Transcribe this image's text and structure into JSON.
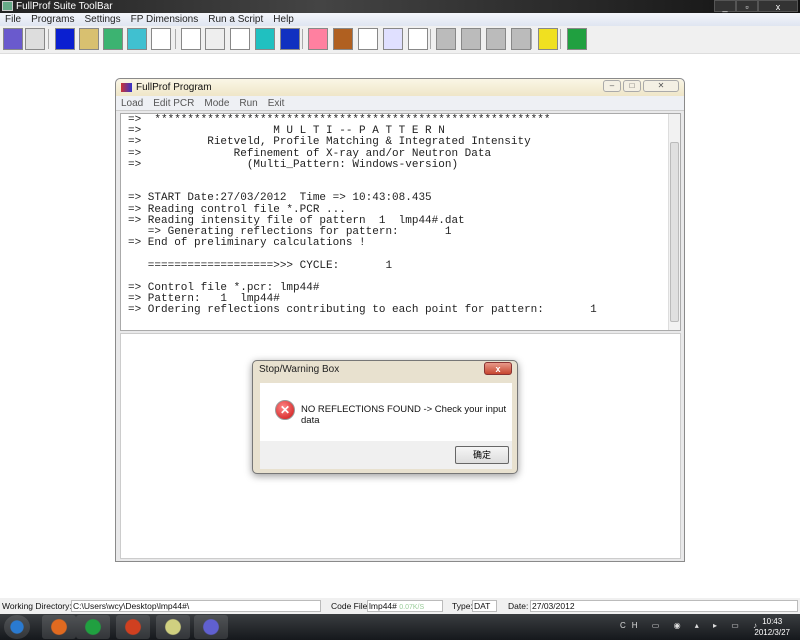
{
  "app": {
    "title": "FullProf Suite ToolBar",
    "window_controls": [
      "minimize",
      "restore",
      "close"
    ]
  },
  "menu": [
    "File",
    "Programs",
    "Settings",
    "FP Dimensions",
    "Run a Script",
    "Help"
  ],
  "toolbar_icons": [
    {
      "name": "winplotr-organizer-icon",
      "color": "#6a5acd"
    },
    {
      "name": "edit-file-icon",
      "color": "#dddddd"
    },
    {
      "name": "diffax-icon",
      "color": "#0a1fd0"
    },
    {
      "name": "editpcr-check-icon",
      "color": "#d8c070"
    },
    {
      "name": "bondstr-icon",
      "color": "#3cb371"
    },
    {
      "name": "tessel-icon",
      "color": "#40c0d0"
    },
    {
      "name": "k-search-icon",
      "color": "#ffffff"
    },
    {
      "name": "edpcr-icon",
      "color": "#ffffff"
    },
    {
      "name": "fullprof-icon",
      "color": "#eeeeee"
    },
    {
      "name": "winplotr-icon",
      "color": "#ffffff"
    },
    {
      "name": "winplotr-2006-icon",
      "color": "#20c0c0"
    },
    {
      "name": "fp-studio-icon",
      "color": "#1030c0"
    },
    {
      "name": "gfourier-icon",
      "color": "#ff80a0"
    },
    {
      "name": "mem-icon",
      "color": "#b06020"
    },
    {
      "name": "basireps-icon",
      "color": "#ffffff"
    },
    {
      "name": "supercell-icon",
      "color": "#e0e0ff"
    },
    {
      "name": "cells-icon",
      "color": "#ffffff"
    },
    {
      "name": "disabled-tool-1-icon",
      "color": "#bbbbbb"
    },
    {
      "name": "disabled-tool-2-icon",
      "color": "#bbbbbb"
    },
    {
      "name": "disabled-tool-3-icon",
      "color": "#bbbbbb"
    },
    {
      "name": "disabled-tool-4-icon",
      "color": "#bbbbbb"
    },
    {
      "name": "help-icon",
      "color": "#f0e020"
    },
    {
      "name": "web-globe-icon",
      "color": "#20a040"
    }
  ],
  "program_window": {
    "title": "FullProf Program",
    "menu": [
      "Load",
      "Edit PCR",
      "Mode",
      "Run",
      "Exit"
    ],
    "console": "=>  ************************************************************\n=>                    M U L T I -- P A T T E R N\n=>          Rietveld, Profile Matching & Integrated Intensity\n=>              Refinement of X-ray and/or Neutron Data\n=>                (Multi_Pattern: Windows-version)\n\n\n=> START Date:27/03/2012  Time => 10:43:08.435\n=> Reading control file *.PCR ...\n=> Reading intensity file of pattern  1  lmp44#.dat\n   => Generating reflections for pattern:       1\n=> End of preliminary calculations !\n\n   ===================>>> CYCLE:       1\n\n=> Control file *.pcr: lmp44#\n=> Pattern:   1  lmp44#\n=> Ordering reflections contributing to each point for pattern:       1"
  },
  "dialog": {
    "title": "Stop/Warning Box",
    "close": "x",
    "message": "NO REFLECTIONS FOUND -> Check your input data",
    "ok_label": "确定"
  },
  "status": {
    "working_dir_label": "Working Directory:",
    "working_dir": "C:\\Users\\wcy\\Desktop\\lmp44#\\",
    "code_file_label": "Code File:",
    "code_file": "lmp44#",
    "net_speed": "0.07K/S",
    "type_label": "Type:",
    "type": "DAT",
    "date_label": "Date:",
    "date": "27/03/2012"
  },
  "taskbar": {
    "time": "10:43",
    "date": "2012/3/27",
    "lang": "CH",
    "buttons": [
      {
        "name": "start-button",
        "color": "#2a7ad0"
      },
      {
        "name": "taskbar-explorer",
        "color": "#e06a20"
      },
      {
        "name": "taskbar-ie",
        "color": "#20a040"
      },
      {
        "name": "taskbar-app",
        "color": "#d04020"
      },
      {
        "name": "taskbar-fps-toolbar",
        "color": "#d0d080"
      },
      {
        "name": "taskbar-fullprof",
        "color": "#6060d0"
      }
    ]
  }
}
